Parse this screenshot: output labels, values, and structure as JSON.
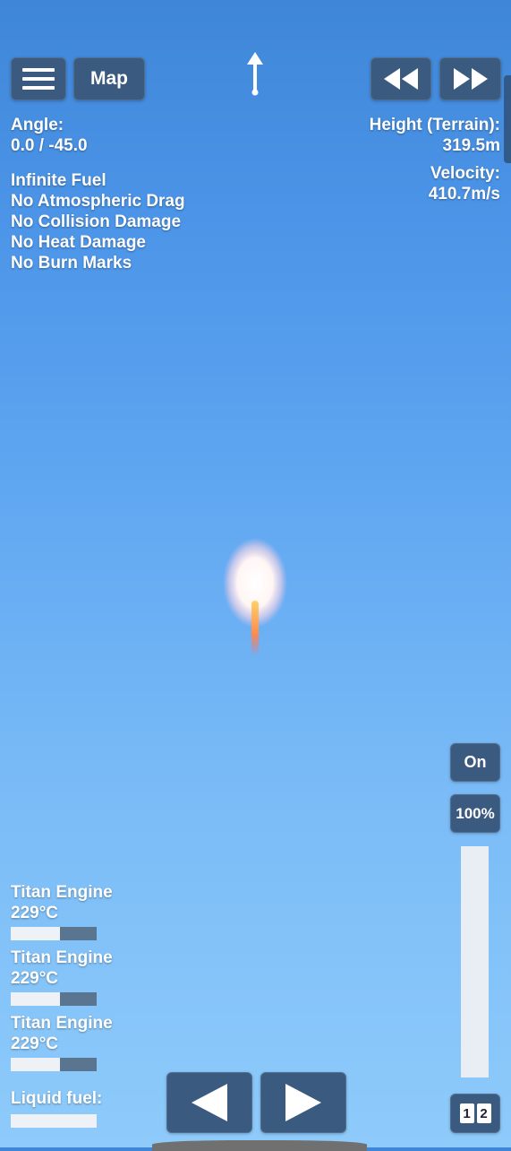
{
  "hud": {
    "map_label": "Map",
    "angle_label": "Angle:",
    "angle_value": "0.0 / -45.0",
    "flags": [
      "Infinite Fuel",
      "No Atmospheric Drag",
      "No Collision Damage",
      "No Heat Damage",
      "No Burn Marks"
    ],
    "height_label": "Height (Terrain):",
    "height_value": "319.5m",
    "velocity_label": "Velocity:",
    "velocity_value": "410.7m/s"
  },
  "controls": {
    "toggle_label": "On",
    "throttle_label": "100%",
    "throttle_level": 1.0,
    "stage_numbers": [
      "1",
      "2"
    ]
  },
  "engines": [
    {
      "name": "Titan Engine",
      "temp": "229°C",
      "level": 0.57
    },
    {
      "name": "Titan Engine",
      "temp": "229°C",
      "level": 0.57
    },
    {
      "name": "Titan Engine",
      "temp": "229°C",
      "level": 0.57
    }
  ],
  "fuel": {
    "label": "Liquid fuel:",
    "level": 1.0
  },
  "icons": {
    "menu": "hamburger-icon",
    "rewind": "rewind-icon",
    "fast_forward": "fast-forward-icon",
    "prograde": "prograde-arrow-icon",
    "left": "rotate-left-icon",
    "right": "rotate-right-icon"
  }
}
